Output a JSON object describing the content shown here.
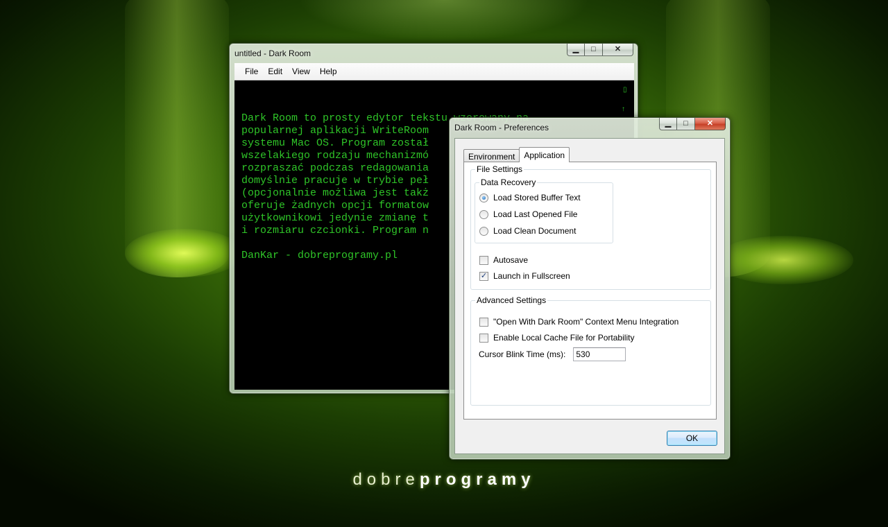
{
  "editor": {
    "title": "untitled - Dark Room",
    "menu": [
      "File",
      "Edit",
      "View",
      "Help"
    ],
    "text_lines": [
      "Dark Room to prosty edytor tekstu wzorowany na",
      "popularnej aplikacji WriteRoom",
      "systemu Mac OS. Program został",
      "wszelakiego rodzaju mechanizmó",
      "rozpraszać podczas redagowania",
      "domyślnie pracuje w trybie peł",
      "(opcjonalnie możliwa jest takż",
      "oferuje żadnych opcji formatow",
      "użytkownikowi jedynie zmianę t",
      "i rozmiaru czcionki. Program n",
      "",
      "DanKar - dobreprogramy.pl"
    ],
    "text_color": "#2fc528",
    "background_color": "#000000"
  },
  "prefs": {
    "title": "Dark Room - Preferences",
    "tabs": [
      {
        "label": "Environment",
        "active": false
      },
      {
        "label": "Application",
        "active": true
      }
    ],
    "file_settings": {
      "label": "File Settings",
      "data_recovery": {
        "label": "Data Recovery",
        "options": [
          {
            "label": "Load Stored Buffer Text",
            "selected": true
          },
          {
            "label": "Load Last Opened File",
            "selected": false
          },
          {
            "label": "Load Clean Document",
            "selected": false
          }
        ]
      },
      "autosave": {
        "label": "Autosave",
        "checked": false
      },
      "launch_fullscreen": {
        "label": "Launch in Fullscreen",
        "checked": true
      }
    },
    "advanced_settings": {
      "label": "Advanced Settings",
      "context_menu": {
        "label": "\"Open With Dark Room\" Context Menu Integration",
        "checked": false
      },
      "local_cache": {
        "label": "Enable Local Cache File for Portability",
        "checked": false
      },
      "cursor_blink": {
        "label": "Cursor Blink Time (ms):",
        "value": "530"
      }
    },
    "ok_label": "OK"
  },
  "caption_buttons": {
    "minimize": "▁",
    "maximize": "□",
    "close": "✕"
  },
  "brand": {
    "part1": "dobre",
    "part2": "programy"
  }
}
